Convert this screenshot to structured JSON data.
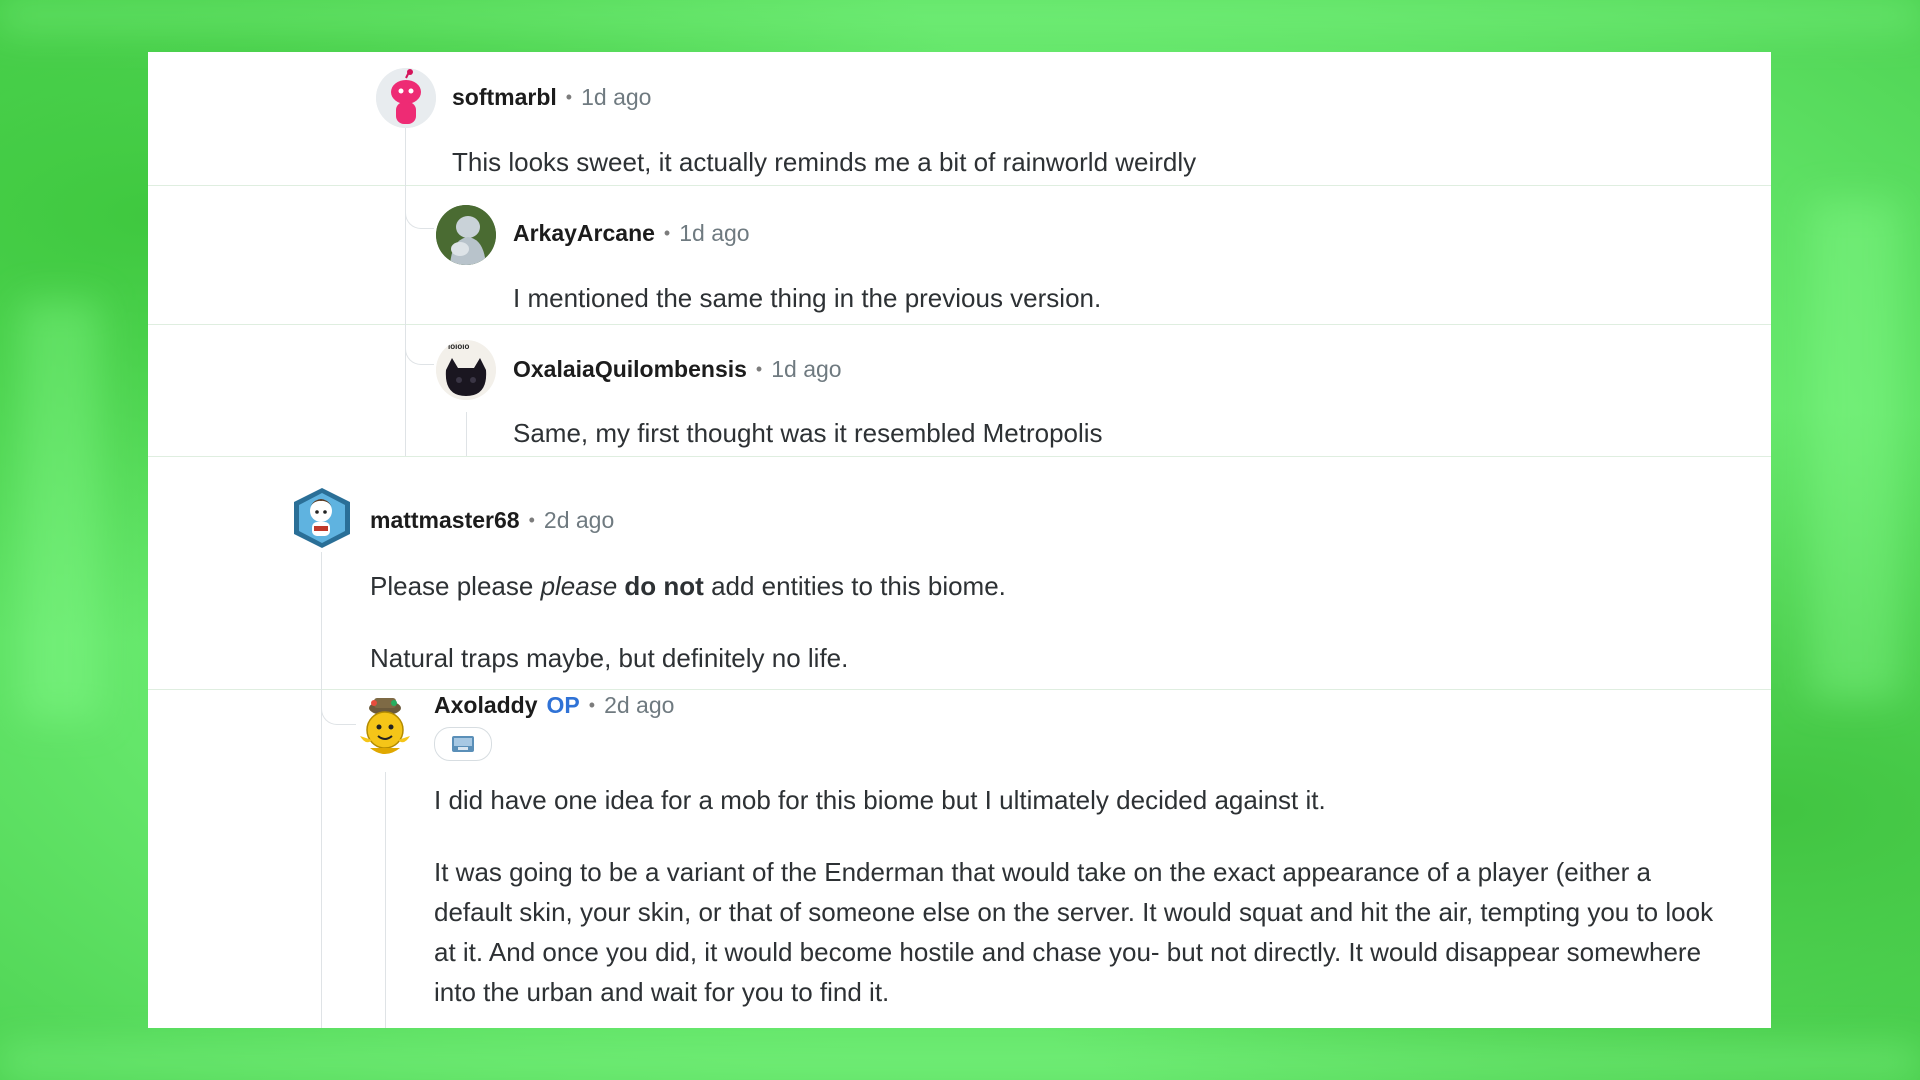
{
  "comments": [
    {
      "author": "softmarbl",
      "sep": "•",
      "time": "1d ago",
      "avatar_icon": "snoo-pink-avatar-icon",
      "body": "This looks sweet, it actually reminds me a bit of rainworld weirdly"
    },
    {
      "author": "ArkayArcane",
      "sep": "•",
      "time": "1d ago",
      "avatar_icon": "statue-avatar-icon",
      "body": "I mentioned the same thing in the previous version."
    },
    {
      "author": "OxalaiaQuilombensis",
      "sep": "•",
      "time": "1d ago",
      "avatar_icon": "black-cat-avatar-icon",
      "avatar_text": "ıoıoıo",
      "body": "Same, my first thought was it resembled Metropolis"
    },
    {
      "author": "mattmaster68",
      "sep": "•",
      "time": "2d ago",
      "avatar_icon": "snoo-hexagon-avatar-icon",
      "body_pre": "Please please ",
      "body_em": "please",
      "body_mid": " ",
      "body_strong": "do not",
      "body_post": " add entities to this biome.",
      "body_p2": "Natural traps maybe, but definitely no life."
    },
    {
      "author": "Axoladdy",
      "op_badge": "OP",
      "sep": "•",
      "time": "2d ago",
      "avatar_icon": "yellow-snoo-avatar-icon",
      "flair_icon": "image-flair-icon",
      "body_p1": "I did have one idea for a mob for this biome but I ultimately decided against it.",
      "body_p2": "It was going to be a variant of the Enderman that would take on the exact appearance of a player (either a default skin, your skin, or that of someone else on the server. It would squat and hit the air, tempting you to look at it. And once you did, it would become hostile and chase you- but not directly. It would disappear somewhere into the urban and wait for you to find it."
    }
  ],
  "colors": {
    "background": "#6eea72",
    "card": "#ffffff",
    "op_badge": "#2f72d6",
    "timestamp": "#6f7a80"
  }
}
